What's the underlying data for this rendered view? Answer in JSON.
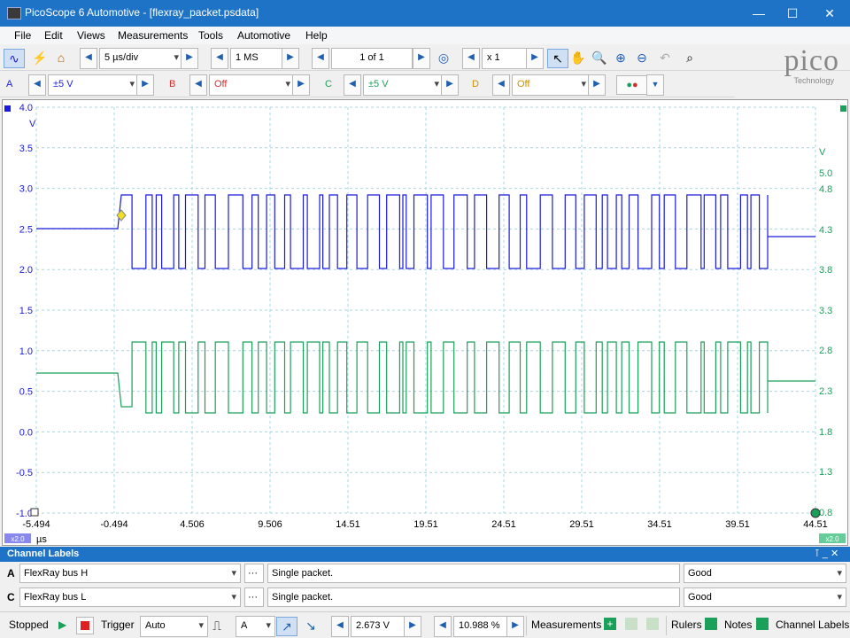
{
  "window": {
    "title": "PicoScope 6 Automotive - [flexray_packet.psdata]",
    "minimize": "—",
    "maximize": "☐",
    "close": "✕"
  },
  "menu": [
    {
      "label": "File"
    },
    {
      "label": "Edit"
    },
    {
      "label": "Views"
    },
    {
      "label": "Measurements"
    },
    {
      "label": "Tools"
    },
    {
      "label": "Automotive"
    },
    {
      "label": "Help"
    }
  ],
  "toolbar1": {
    "timebase": "5 µs/div",
    "samples": "1 MS",
    "buffer": "1 of 1",
    "zoom": "x 1"
  },
  "toolbar2": {
    "ch_a": {
      "letter": "A",
      "range": "±5 V"
    },
    "ch_b": {
      "letter": "B",
      "range": "Off"
    },
    "ch_c": {
      "letter": "C",
      "range": "±5 V"
    },
    "ch_d": {
      "letter": "D",
      "range": "Off"
    }
  },
  "logo": {
    "word": "pico",
    "sub": "Technology"
  },
  "scope": {
    "left_axis_ticks": [
      "4.0",
      "3.5",
      "3.0",
      "2.5",
      "2.0",
      "1.5",
      "1.0",
      "0.5",
      "0.0",
      "-0.5",
      "-1.0"
    ],
    "left_unit": "V",
    "right_axis_ticks": [
      "5.0",
      "4.8",
      "4.3",
      "3.8",
      "3.3",
      "2.8",
      "2.3",
      "1.8",
      "1.3",
      "0.8"
    ],
    "right_unit": "V",
    "x_ticks": [
      "-5.494",
      "-0.494",
      "4.506",
      "9.506",
      "14.51",
      "19.51",
      "24.51",
      "29.51",
      "34.51",
      "39.51",
      "44.51"
    ],
    "x_unit": "µs",
    "left_zoom_badge": "x2.0",
    "right_zoom_badge": "x2.0",
    "color_a": "#1a1adc",
    "color_c": "#1aa05a"
  },
  "channel_labels": {
    "header": "Channel Labels",
    "rows": [
      {
        "channel": "A",
        "name": "FlexRay bus H",
        "description": "Single packet.",
        "status": "Good"
      },
      {
        "channel": "C",
        "name": "FlexRay bus L",
        "description": "Single packet.",
        "status": "Good"
      }
    ],
    "more_button": "···",
    "pin": "⊺ _ ✕"
  },
  "statusbar": {
    "state": "Stopped",
    "trigger_label": "Trigger",
    "trigger_mode": "Auto",
    "trigger_channel": "A",
    "trigger_level": "2.673 V",
    "trigger_pretrigger": "10.988 %",
    "measurements": "Measurements",
    "rulers": "Rulers",
    "notes": "Notes",
    "channel_labels": "Channel Labels"
  }
}
